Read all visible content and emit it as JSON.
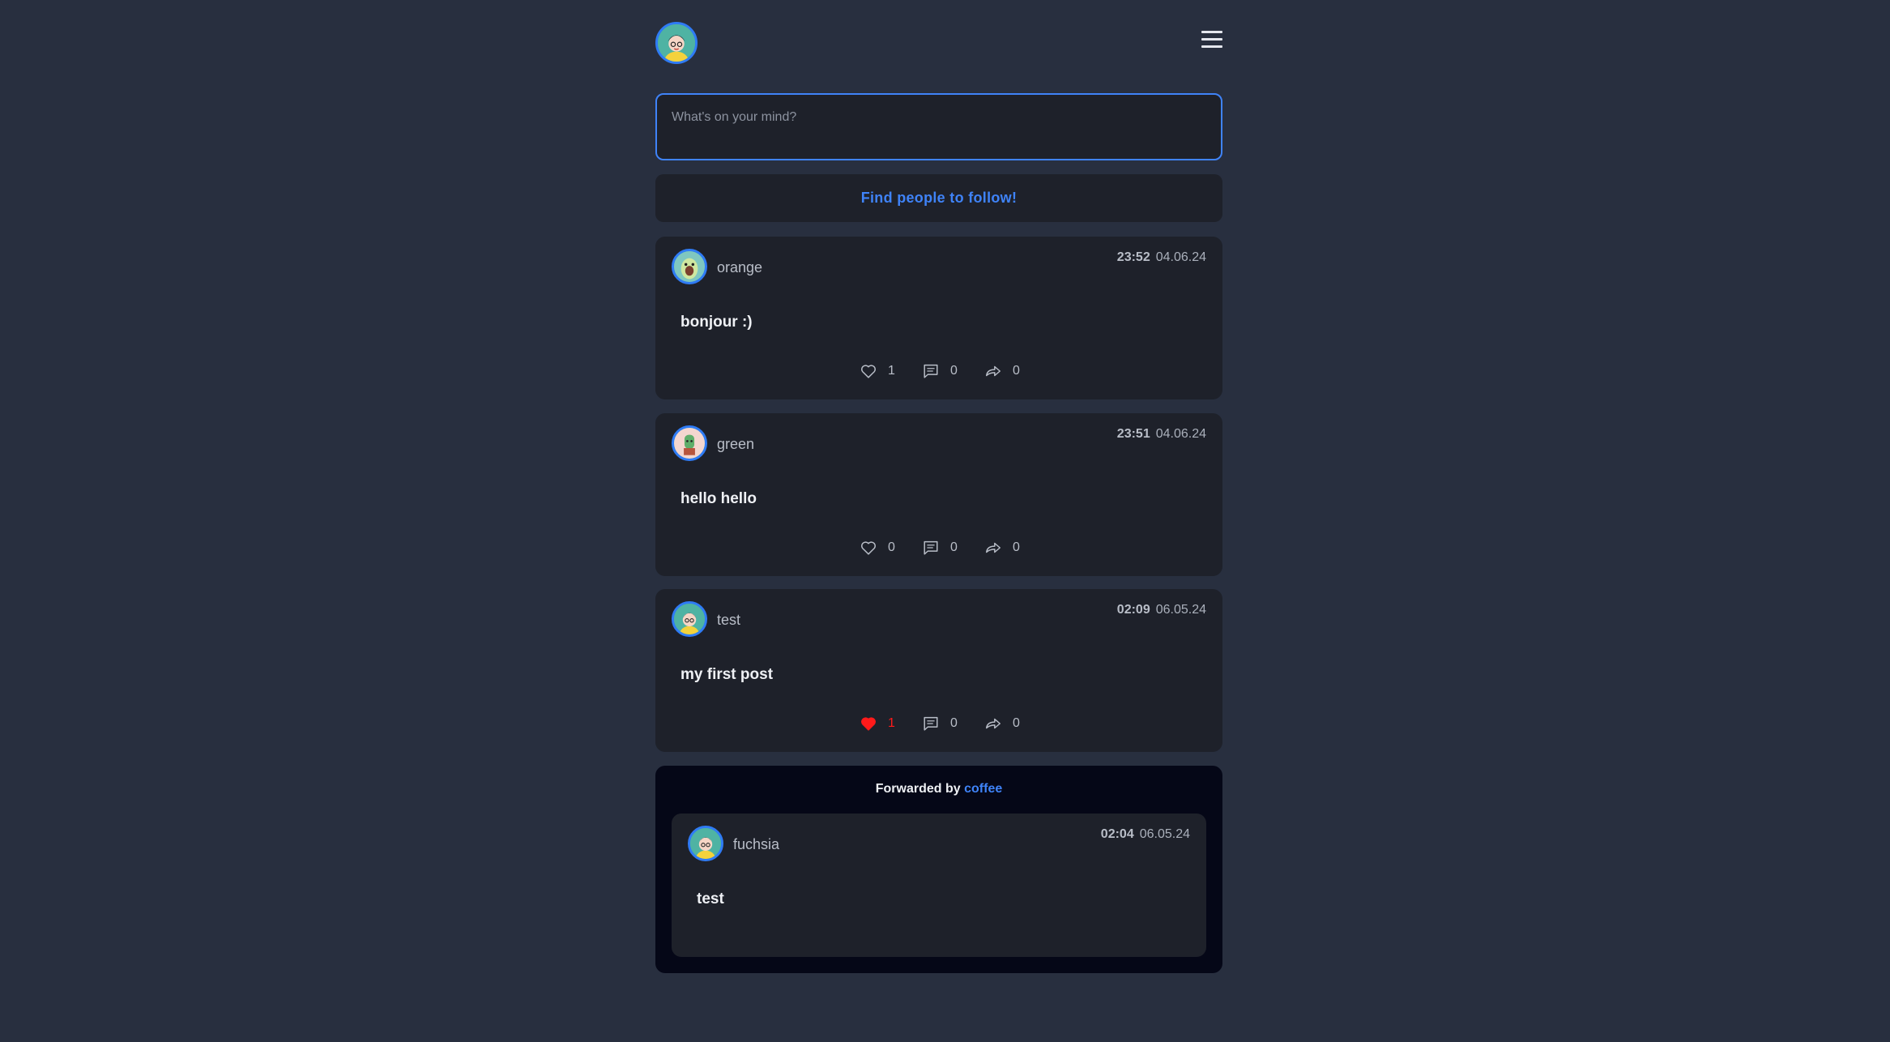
{
  "header": {
    "menu_icon": "hamburger-icon"
  },
  "composer": {
    "placeholder": "What's on your mind?"
  },
  "find_people": {
    "label": "Find people to follow!"
  },
  "posts": [
    {
      "username": "orange",
      "time": "23:52",
      "date": "04.06.24",
      "text": "bonjour :)",
      "likes": "1",
      "comments": "0",
      "shares": "0",
      "liked": false
    },
    {
      "username": "green",
      "time": "23:51",
      "date": "04.06.24",
      "text": "hello hello",
      "likes": "0",
      "comments": "0",
      "shares": "0",
      "liked": false
    },
    {
      "username": "test",
      "time": "02:09",
      "date": "06.05.24",
      "text": "my first post",
      "likes": "1",
      "comments": "0",
      "shares": "0",
      "liked": true
    }
  ],
  "forwarded": {
    "prefix": "Forwarded by",
    "by_user": "coffee",
    "post": {
      "username": "fuchsia",
      "time": "02:04",
      "date": "06.05.24",
      "text": "test"
    }
  },
  "colors": {
    "accent": "#3f83f8",
    "liked": "#ff1a1a",
    "background": "#282f3f",
    "card": "#1e212a"
  }
}
